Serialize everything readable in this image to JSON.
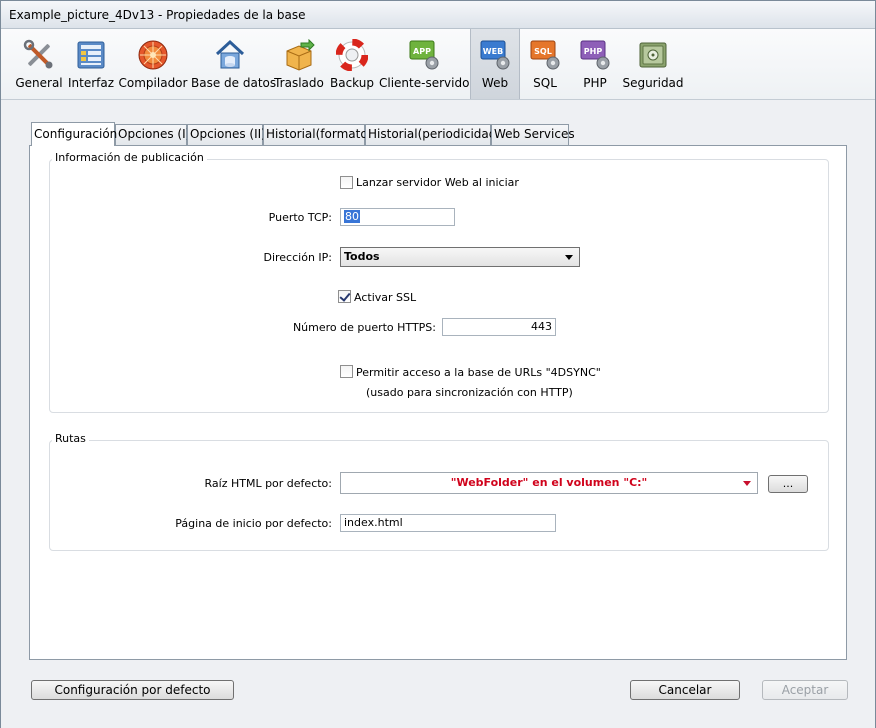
{
  "window": {
    "title": "Example_picture_4Dv13 - Propiedades de la base"
  },
  "toolbar": {
    "items": [
      {
        "label": "General",
        "icon": "tools-icon"
      },
      {
        "label": "Interfaz",
        "icon": "interface-icon"
      },
      {
        "label": "Compilador",
        "icon": "compiler-icon"
      },
      {
        "label": "Base de datos",
        "icon": "database-house-icon"
      },
      {
        "label": "Traslado",
        "icon": "box-move-icon"
      },
      {
        "label": "Backup",
        "icon": "lifebuoy-icon"
      },
      {
        "label": "Cliente-servidor",
        "icon": "app-gear-icon",
        "badge": "APP"
      },
      {
        "label": "Web",
        "icon": "web-gear-icon",
        "badge": "WEB",
        "selected": true
      },
      {
        "label": "SQL",
        "icon": "sql-gear-icon",
        "badge": "SQL"
      },
      {
        "label": "PHP",
        "icon": "php-gear-icon",
        "badge": "PHP"
      },
      {
        "label": "Seguridad",
        "icon": "safe-icon"
      }
    ]
  },
  "tabs": [
    {
      "label": "Configuración",
      "active": true
    },
    {
      "label": "Opciones (I)"
    },
    {
      "label": "Opciones (II)"
    },
    {
      "label": "Historial(formato)"
    },
    {
      "label": "Historial(periodicidad)"
    },
    {
      "label": "Web Services"
    }
  ],
  "publication": {
    "title": "Información de publicación",
    "launch_label": "Lanzar servidor Web al iniciar",
    "launch_checked": false,
    "tcp_label": "Puerto TCP:",
    "tcp_value": "80",
    "ip_label": "Dirección IP:",
    "ip_value": "Todos",
    "ssl_label": "Activar SSL",
    "ssl_checked": true,
    "https_label": "Número de puerto HTTPS:",
    "https_value": "443",
    "sync_label": "Permitir acceso a la base de URLs \"4DSYNC\"",
    "sync_checked": false,
    "sync_note": "(usado para sincronización con HTTP)"
  },
  "paths": {
    "title": "Rutas",
    "root_label": "Raíz HTML por defecto:",
    "root_value": "\"WebFolder\" en el volumen \"C:\"",
    "browse_label": "...",
    "home_label": "Página de inicio por defecto:",
    "home_value": "index.html"
  },
  "footer": {
    "default_label": "Configuración por defecto",
    "cancel_label": "Cancelar",
    "accept_label": "Aceptar"
  },
  "colors": {
    "selected_text_bg": "#3875d7",
    "path_text": "#d0021b"
  }
}
